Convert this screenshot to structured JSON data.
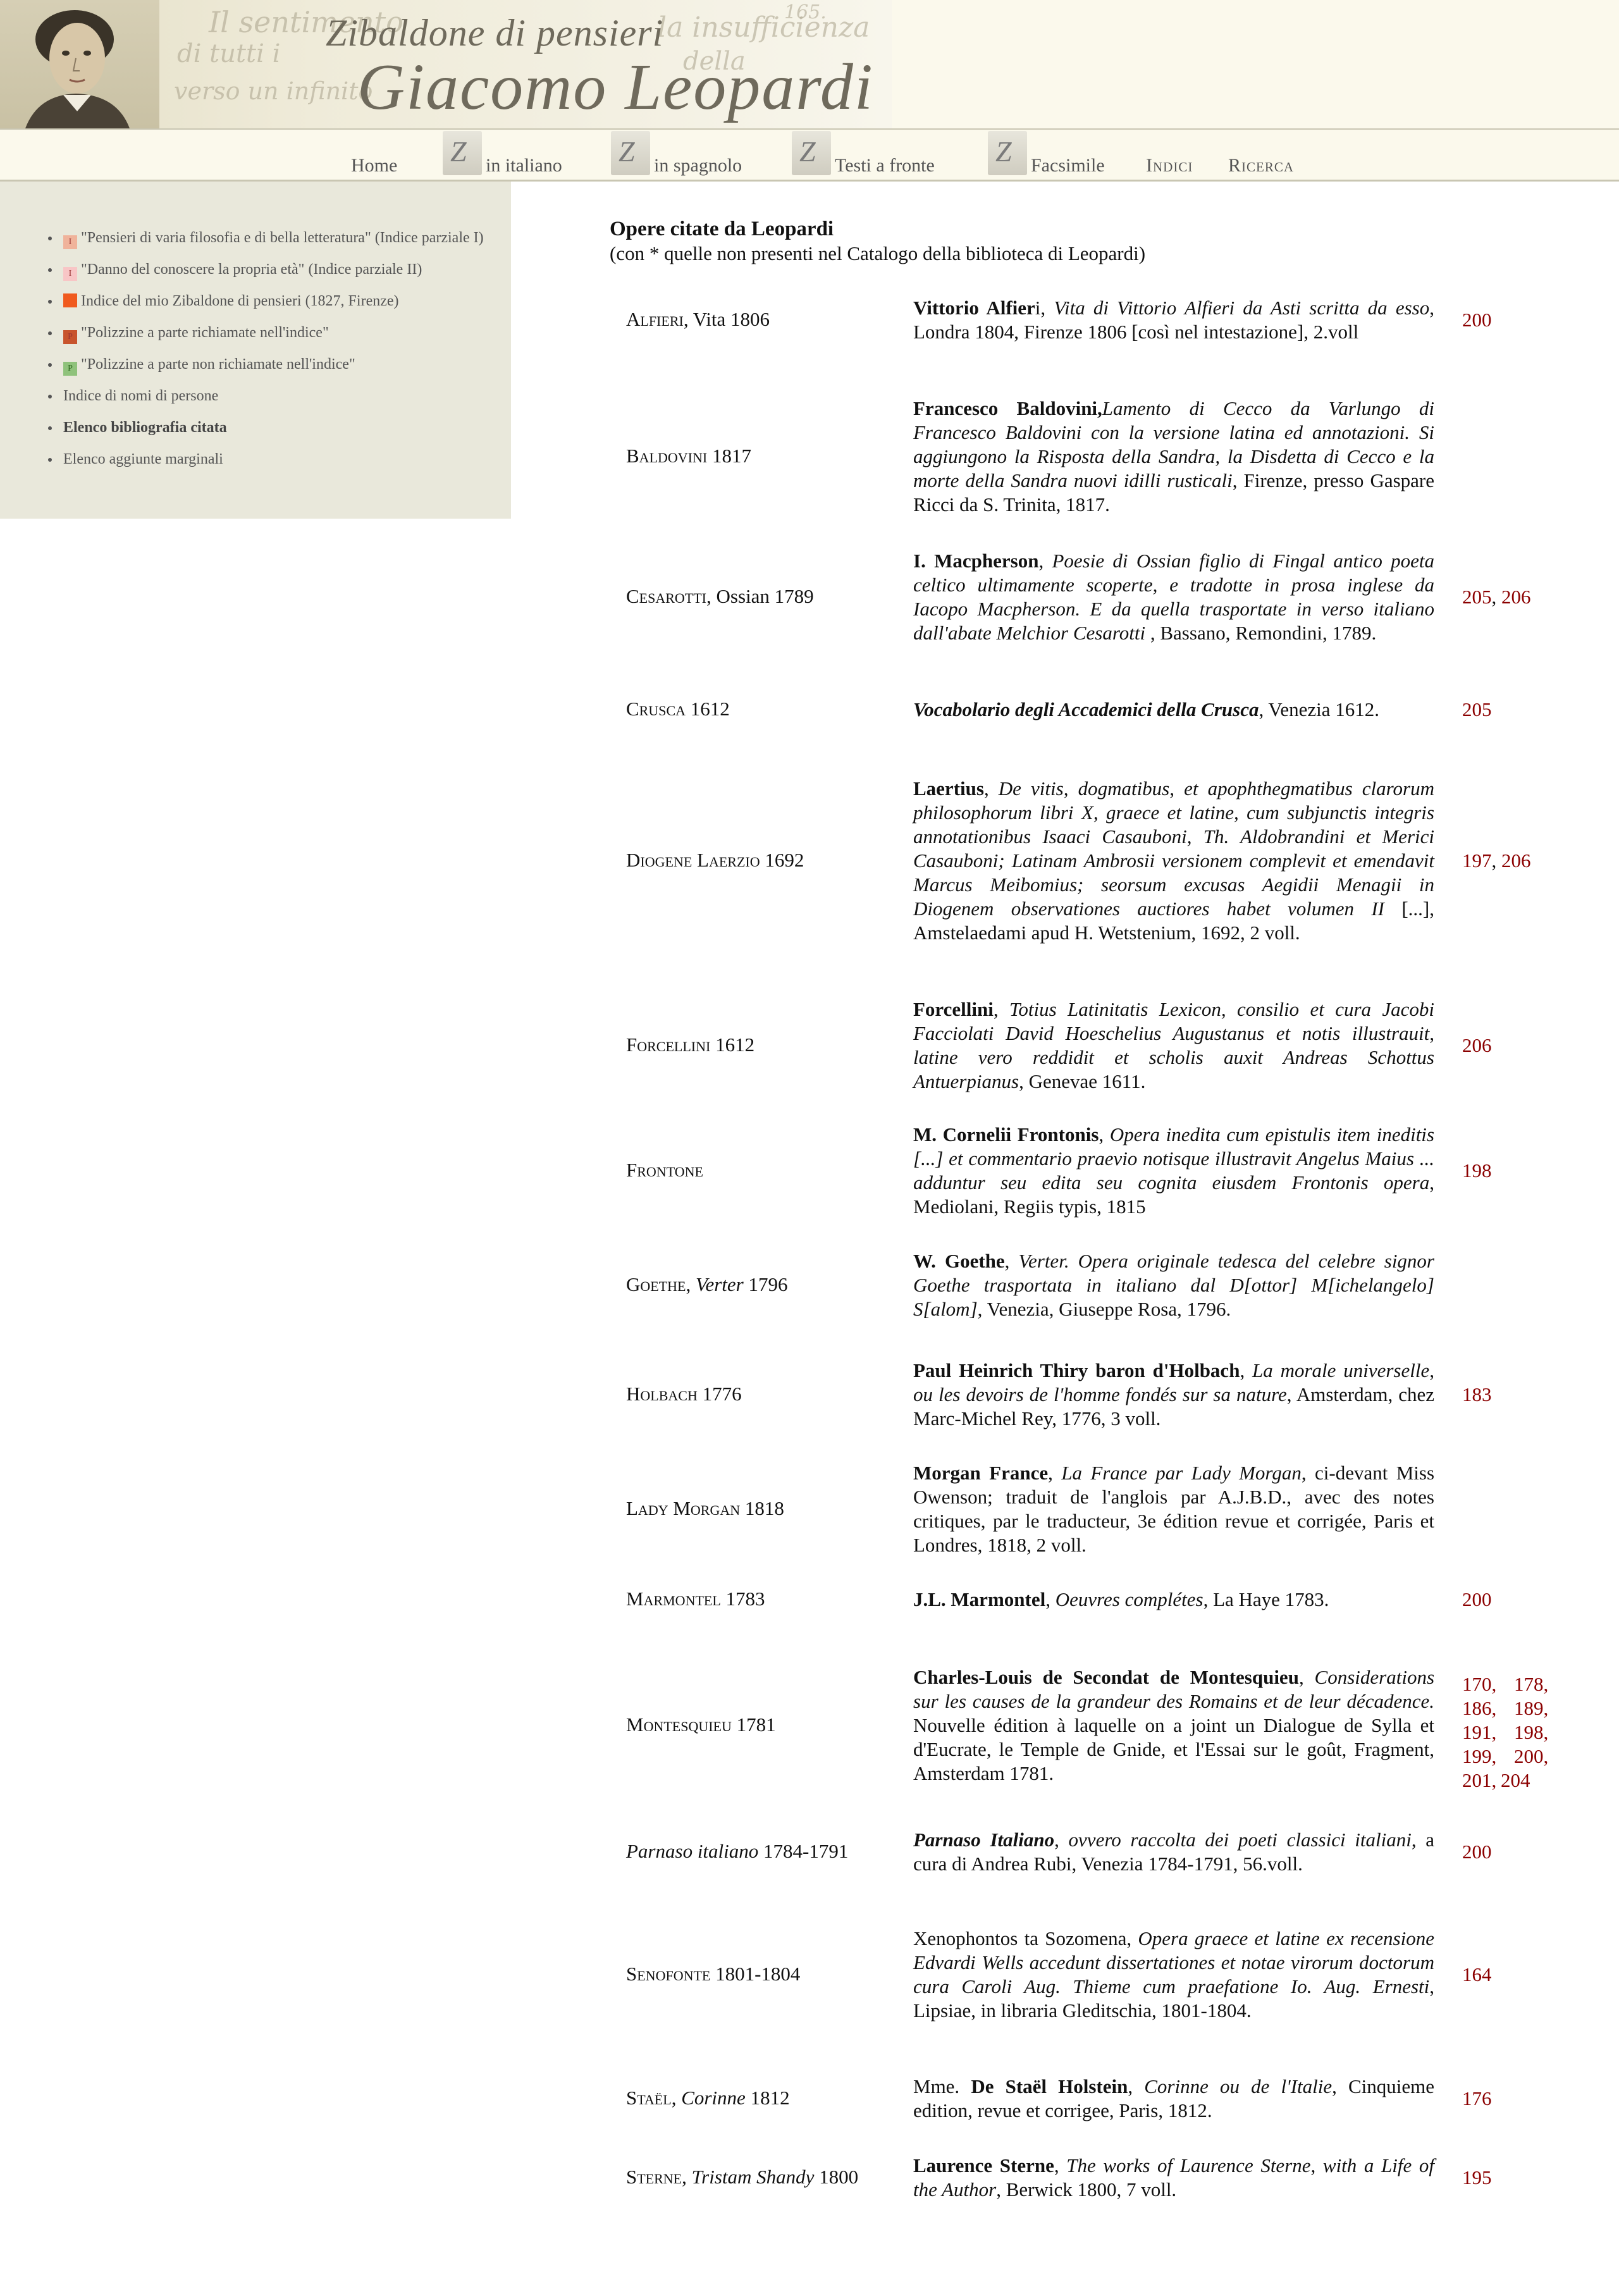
{
  "header": {
    "subtitle": "Zibaldone di pensieri",
    "title": "Giacomo Leopardi"
  },
  "nav": {
    "home": "Home",
    "italiano": "in italiano",
    "spagnolo": "in spagnolo",
    "fronte": "Testi a fronte",
    "facsimile": "Facsimile",
    "indici": "Indici",
    "ricerca": "Ricerca"
  },
  "sidebar": {
    "items": [
      {
        "marker": "I",
        "label": "\"Pensieri di varia filosofia e di bella letteratura\" (Indice parziale I)"
      },
      {
        "marker": "I",
        "label": "\"Danno del conoscere la propria età\" (Indice parziale II)"
      },
      {
        "marker": "",
        "label": "Indice del mio Zibaldone di pensieri (1827, Firenze)"
      },
      {
        "marker": "P",
        "label": "\"Polizzine a parte richiamate nell'indice\""
      },
      {
        "marker": "P",
        "label": "\"Polizzine a parte non richiamate nell'indice\""
      },
      {
        "marker": "",
        "label": "Indice di nomi di persone"
      },
      {
        "marker": "",
        "label": "Elenco bibliografia citata"
      },
      {
        "marker": "",
        "label": "Elenco aggiunte marginali"
      }
    ]
  },
  "main": {
    "title": "Opere citate da Leopardi",
    "subtitle": "(con * quelle non presenti nel Catalogo della biblioteca di Leopardi)"
  },
  "rows": [
    {
      "key": [
        {
          "t": "Alfieri",
          "sc": true
        },
        {
          "t": ", Vita 1806"
        }
      ],
      "ref": [
        {
          "t": "Vittorio Alfier",
          "b": true
        },
        {
          "t": "i, "
        },
        {
          "t": "Vita di Vittorio Alfieri da Asti scritta da esso",
          "i": true
        },
        {
          "t": ", Londra 1804, Firenze 1806 [così nel intestazione], 2.voll"
        }
      ],
      "pages": [
        "200"
      ]
    },
    {
      "key": [
        {
          "t": "Baldovini",
          "sc": true
        },
        {
          "t": " 1817"
        }
      ],
      "ref": [
        {
          "t": "Francesco Baldovini,",
          "b": true
        },
        {
          "t": "Lamento di Cecco da Varlungo di Francesco Baldovini con la versione latina ed annotazioni. Si aggiungono la Risposta della Sandra, la Disdetta di Cecco e la morte della Sandra nuovi idilli rusticali",
          "i": true
        },
        {
          "t": ", Firenze, presso Gaspare Ricci da S. Trinita, 1817."
        }
      ],
      "pages": []
    },
    {
      "key": [
        {
          "t": "Cesarotti",
          "sc": true
        },
        {
          "t": ", Ossian 1789"
        }
      ],
      "ref": [
        {
          "t": "I. Macpherson",
          "b": true
        },
        {
          "t": ", "
        },
        {
          "t": "Poesie di Ossian figlio di Fingal antico poeta celtico ultimamente scoperte, e tradotte in prosa inglese da Iacopo Macpherson. E da quella trasportate in verso italiano dall'abate Melchior Cesarotti",
          "i": true
        },
        {
          "t": " , Bassano, Remondini, 1789."
        }
      ],
      "pages": [
        "205",
        "206"
      ]
    },
    {
      "key": [
        {
          "t": "Crusca",
          "sc": true
        },
        {
          "t": " 1612"
        }
      ],
      "ref": [
        {
          "t": "Vocabolario degli Accademici della Crusca",
          "b": true,
          "i": true
        },
        {
          "t": ", Venezia 1612."
        }
      ],
      "pages": [
        "205"
      ]
    },
    {
      "key": [
        {
          "t": "Diogene Laerzio",
          "sc": true
        },
        {
          "t": " 1692"
        }
      ],
      "ref": [
        {
          "t": "Laertius",
          "b": true
        },
        {
          "t": ", "
        },
        {
          "t": "De vitis, dogmatibus, et apophthegmatibus clarorum philosophorum libri X, graece et latine, cum subjunctis integris annotationibus Isaaci Casauboni, Th. Aldobrandini et Merici Casauboni; Latinam Ambrosii versionem complevit et emendavit Marcus Meibomius; seorsum excusas Aegidii Menagii in Diogenem observationes auctiores habet volumen II",
          "i": true
        },
        {
          "t": " [...], Amstelaedami apud H. Wetstenium, 1692, 2 voll."
        }
      ],
      "pages": [
        "197",
        "206"
      ]
    },
    {
      "key": [
        {
          "t": "Forcellini",
          "sc": true
        },
        {
          "t": " 1612"
        }
      ],
      "ref": [
        {
          "t": "Forcellini",
          "b": true
        },
        {
          "t": ", "
        },
        {
          "t": "Totius Latinitatis Lexicon, consilio et cura Jacobi Facciolati David Hoeschelius Augustanus et notis illustrauit, latine vero reddidit et scholis auxit Andreas Schottus Antuerpianus",
          "i": true
        },
        {
          "t": ", Genevae 1611."
        }
      ],
      "pages": [
        "206"
      ]
    },
    {
      "key": [
        {
          "t": "Frontone",
          "sc": true
        }
      ],
      "ref": [
        {
          "t": "M. Cornelii Frontonis",
          "b": true
        },
        {
          "t": ", "
        },
        {
          "t": "Opera inedita cum epistulis item ineditis [...] et commentario praevio notisque illustravit Angelus Maius ... adduntur seu edita seu cognita eiusdem Frontonis opera",
          "i": true
        },
        {
          "t": ", Mediolani, Regiis typis, 1815"
        }
      ],
      "pages": [
        "198"
      ]
    },
    {
      "key": [
        {
          "t": "Goethe",
          "sc": true
        },
        {
          "t": ", "
        },
        {
          "t": "Verter",
          "i": true
        },
        {
          "t": " 1796"
        }
      ],
      "ref": [
        {
          "t": "W. Goethe",
          "b": true
        },
        {
          "t": ", "
        },
        {
          "t": "Verter. Opera originale tedesca del celebre signor Goethe trasportata in italiano dal D[ottor] M[ichelangelo] S[alom]",
          "i": true
        },
        {
          "t": ", Venezia, Giuseppe Rosa, 1796."
        }
      ],
      "pages": []
    },
    {
      "key": [
        {
          "t": "Holbach",
          "sc": true
        },
        {
          "t": " 1776"
        }
      ],
      "ref": [
        {
          "t": "Paul Heinrich Thiry baron d'Holbach",
          "b": true
        },
        {
          "t": ", "
        },
        {
          "t": "La morale universelle, ou les devoirs de l'homme fondés sur sa nature",
          "i": true
        },
        {
          "t": ", Amsterdam, chez Marc-Michel Rey, 1776, 3 voll."
        }
      ],
      "pages": [
        "183"
      ]
    },
    {
      "key": [
        {
          "t": "Lady Morgan",
          "sc": true
        },
        {
          "t": " 1818"
        }
      ],
      "ref": [
        {
          "t": "Morgan France",
          "b": true
        },
        {
          "t": ", "
        },
        {
          "t": "La France par Lady Morgan",
          "i": true
        },
        {
          "t": ", ci-devant Miss Owenson; traduit de l'anglois par A.J.B.D., avec des notes critiques, par le traducteur, 3e édition revue et corrigée, Paris et Londres, 1818, 2 voll."
        }
      ],
      "pages": []
    },
    {
      "key": [
        {
          "t": "Marmontel",
          "sc": true
        },
        {
          "t": " 1783"
        }
      ],
      "ref": [
        {
          "t": "J.L. Marmontel",
          "b": true
        },
        {
          "t": ", "
        },
        {
          "t": "Oeuvres complétes",
          "i": true
        },
        {
          "t": ", La Haye 1783."
        }
      ],
      "pages": [
        "200"
      ]
    },
    {
      "key": [
        {
          "t": "Montesquieu",
          "sc": true
        },
        {
          "t": " 1781"
        }
      ],
      "ref": [
        {
          "t": "Charles-Louis de Secondat de Montesquieu",
          "b": true
        },
        {
          "t": ", "
        },
        {
          "t": "Considerations sur les causes de la grandeur des Romains et de leur décadence.",
          "i": true
        },
        {
          "t": " Nouvelle édition à laquelle on a joint un Dialogue de Sylla et d'Eucrate, le Temple de Gnide, et l'Essai sur le goût, Fragment, Amsterdam 1781."
        }
      ],
      "pages": [
        "170",
        "178",
        "186",
        "189",
        "191",
        "198",
        "199",
        "200",
        "201",
        "204"
      ]
    },
    {
      "key": [
        {
          "t": "Parnaso italiano",
          "i": true
        },
        {
          "t": " 1784-1791"
        }
      ],
      "ref": [
        {
          "t": "Parnaso Italiano",
          "b": true,
          "i": true
        },
        {
          "t": ", "
        },
        {
          "t": "ovvero raccolta dei poeti classici italiani",
          "i": true
        },
        {
          "t": ", a cura di Andrea Rubi, Venezia 1784-1791, 56.voll."
        }
      ],
      "pages": [
        "200"
      ]
    },
    {
      "key": [
        {
          "t": "Senofonte",
          "sc": true
        },
        {
          "t": " 1801-1804"
        }
      ],
      "ref": [
        {
          "t": "Xenophontos ta Sozomena, "
        },
        {
          "t": "Opera graece et latine ex recensione Edvardi Wells accedunt dissertationes et notae virorum doctorum cura Caroli Aug. Thieme cum praefatione Io. Aug. Ernesti",
          "i": true
        },
        {
          "t": ", Lipsiae, in libraria Gleditschia, 1801-1804."
        }
      ],
      "pages": [
        "164"
      ]
    },
    {
      "key": [
        {
          "t": "Staël",
          "sc": true
        },
        {
          "t": ", "
        },
        {
          "t": "Corinne",
          "i": true
        },
        {
          "t": " 1812"
        }
      ],
      "ref": [
        {
          "t": "Mme. "
        },
        {
          "t": "De Staël Holstein",
          "b": true
        },
        {
          "t": ", "
        },
        {
          "t": "Corinne ou de l'Italie",
          "i": true
        },
        {
          "t": ", Cinquieme edition, revue et corrigee, Paris, 1812."
        }
      ],
      "pages": [
        "176"
      ]
    },
    {
      "key": [
        {
          "t": "Sterne",
          "sc": true
        },
        {
          "t": ", "
        },
        {
          "t": "Tristam Shandy",
          "i": true
        },
        {
          "t": " 1800"
        }
      ],
      "ref": [
        {
          "t": "Laurence Sterne",
          "b": true
        },
        {
          "t": ", "
        },
        {
          "t": "The works of Laurence Sterne, with a Life of the Author",
          "i": true
        },
        {
          "t": ", Berwick 1800, 7 voll."
        }
      ],
      "pages": [
        "195"
      ]
    }
  ]
}
